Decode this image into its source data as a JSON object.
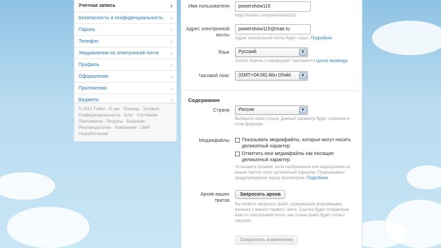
{
  "sidebar": {
    "items": [
      {
        "label": "Учетная запись",
        "active": true
      },
      {
        "label": "Безопасность и конфиденциальность"
      },
      {
        "label": "Пароль"
      },
      {
        "label": "Телефон"
      },
      {
        "label": "Уведомления по электронной почте"
      },
      {
        "label": "Профиль"
      },
      {
        "label": "Оформление"
      },
      {
        "label": "Приложения"
      },
      {
        "label": "Виджеты"
      }
    ],
    "chevron": "›",
    "footer": {
      "line1": "© 2013 Twitter · О нас · Помощь · Условия",
      "line2": "Конфиденциальность · Блог · Состояние",
      "line3": "Приложения · Ресурсы · Вакансии",
      "line4": "Рекламодателям · Компаниям · СМИ",
      "line5": "Разработчикам"
    }
  },
  "account": {
    "username_label": "Имя пользователя",
    "username_value": "powershow115",
    "username_url": "https://twitter.com/powershow115",
    "email_label_1": "Адрес электронной",
    "email_label_2": "почты",
    "email_value": "powershow115@mail.ru",
    "email_hint": "Адрес электронной почты будет скрыт.",
    "email_hint_link": "Подробнее",
    "language_label": "Язык",
    "language_value": "Русский",
    "language_hint": "Хотите помочь с переводом? Загляните в",
    "language_hint_link": "Центр перевода",
    "timezone_label": "Часовой пояс",
    "timezone_value": "(GMT+04:00) Abu Dhabi"
  },
  "content": {
    "section_title": "Содержание",
    "country_label": "Страна",
    "country_value": "Россия",
    "country_hint": "Выберите свою страну. Данный параметр будет сохранен в этом браузере.",
    "media_label": "Медиафайлы",
    "media_option_1": "Показывать медиафайлы, которые могут носить деликатный характер",
    "media_option_2": "Отметить мои медиафайлы как носящие деликатный характер",
    "media_hint": "Установите флажок, если изображения или видеоролики из ваших твитов носят деликатный характер. Подсказывает предупреждение перед просмотром.",
    "media_hint_link": "Подробнее",
    "archive_label_1": "Архив ваших",
    "archive_label_2": "твитов",
    "archive_button": "Запросить архив",
    "archive_hint": "Вы можете запросить файл, содержащий информацию, начиная с вашего первого твита. Ссылка будет отправлена вам по электронной почте, как только файл будет готов к загрузке.",
    "save_button": "Сохранить изменения"
  },
  "dropdown_arrow": "▼",
  "colors": {
    "link": "#2a7ab0",
    "background": "#8fc3e3"
  }
}
